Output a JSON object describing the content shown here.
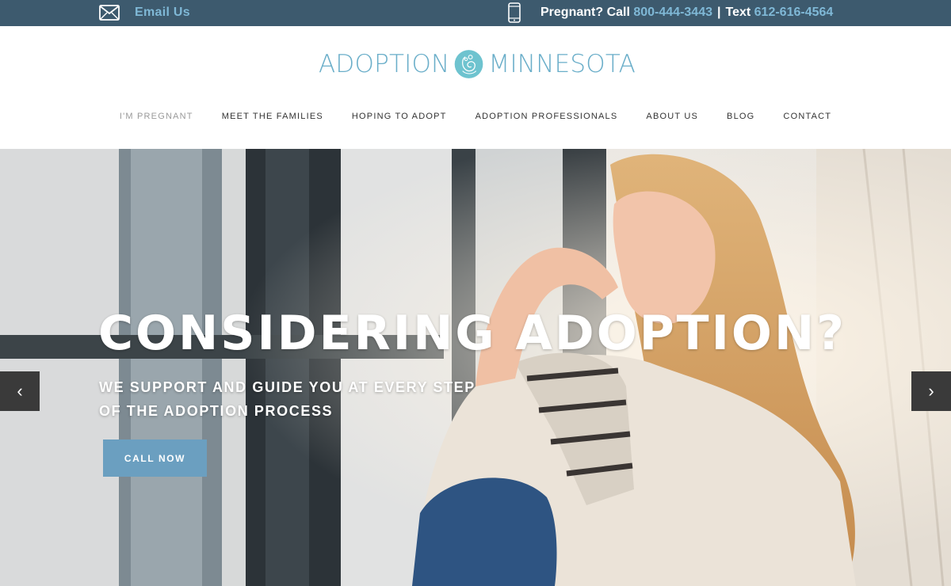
{
  "topbar": {
    "email_label": "Email Us",
    "pregnant_label": "Pregnant? Call",
    "call_number": "800-444-3443",
    "separator": "|",
    "text_label": "Text",
    "text_number": "612-616-4564",
    "email_icon": "envelope-icon",
    "phone_icon": "mobile-phone-icon"
  },
  "logo": {
    "word_left": "ADOPTION",
    "word_right": "MINNESOTA",
    "mark_icon": "mother-child-logo-icon"
  },
  "nav": {
    "items": [
      {
        "label": "I'M PREGNANT"
      },
      {
        "label": "MEET THE FAMILIES"
      },
      {
        "label": "HOPING TO ADOPT"
      },
      {
        "label": "ADOPTION PROFESSIONALS"
      },
      {
        "label": "ABOUT US"
      },
      {
        "label": "BLOG"
      },
      {
        "label": "CONTACT"
      }
    ]
  },
  "hero": {
    "title": "CONSIDERING ADOPTION?",
    "subtitle_line1": "WE SUPPORT AND GUIDE YOU AT EVERY STEP",
    "subtitle_line2": "OF THE ADOPTION PROCESS",
    "cta_label": "CALL NOW",
    "prev_glyph": "‹",
    "next_glyph": "›"
  },
  "colors": {
    "topbar_bg": "#3d5a6e",
    "accent": "#7fb8d6",
    "logo": "#6aaec9",
    "cta_bg": "#6b9fc0",
    "arrow_bg": "#3a3a3a"
  }
}
